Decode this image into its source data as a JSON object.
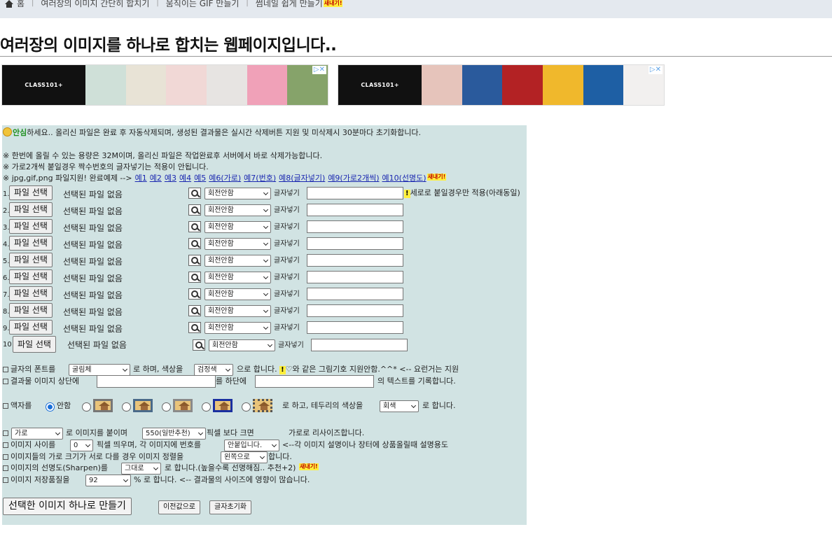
{
  "nav": {
    "home": "홈",
    "links": [
      "여러장의 이미지 간단히 합치기",
      "움직이는 GIF 만들기",
      "썸네일 쉽게 만들기"
    ],
    "new_badge": "새내기!"
  },
  "title": "여러장의 이미지를 하나로 합치는 웹페이지입니다..",
  "ads": [
    {
      "logo": "CLASS101+",
      "tiles": [
        "#cfe0d8",
        "#e8e3d6",
        "#f1d8d6",
        "#e7e4e2",
        "#f0a1b8",
        "#86a36a"
      ]
    },
    {
      "logo": "CLASS101+",
      "tiles": [
        "#e6c4bb",
        "#2a5a9c",
        "#b32224",
        "#f0b82c",
        "#1e5fa4",
        "#f2f0ef"
      ]
    }
  ],
  "notice": {
    "emph": "안심",
    "rest": "하세요.. 올리신 파일은 완료 후 자동삭제되며, 생성된 결과물은 실시간 삭제버튼 지원 및 미삭제시 30분마다 초기화합니다.",
    "line1": "※ 한번에 올릴 수 있는 용량은 32M이며, 올리신 파일은 작업완료후 서버에서 바로 삭제가능합니다.",
    "line2": "※ 가로2개씩 붙일경우 짝수번호의 글자넣기는 적용이 안됩니다.",
    "support_prefix": "※ jpg,gif,png 파일지원! 완료예제 -->",
    "examples": [
      "예1",
      "예2",
      "예3",
      "예4",
      "예5",
      "예6(가로)",
      "예7(번호)",
      "예8(글자넣기)",
      "예9(가로2개씩)",
      "예10(선명도)"
    ],
    "new_badge": "새내기!"
  },
  "file_rows": {
    "button_label": "파일 선택",
    "no_file": "선택된 파일 없음",
    "rotate": "회전안함",
    "text_label": "글자넣기",
    "numbers": [
      "1.",
      "2.",
      "3.",
      "4.",
      "5.",
      "6.",
      "7.",
      "8.",
      "9.",
      "10"
    ],
    "row1_note_badge": "!",
    "row1_note": "세로로 붙일경우만 적용(아래동일)"
  },
  "font_line": {
    "prefix": "글자의 폰트를",
    "font_value": "굴림체",
    "mid": "로 하며, 색상을",
    "color_value": "검정색",
    "suffix": "으로 합니다.",
    "badge": "!",
    "tail": "♡와 같은 그림기호 지원안함.^^* <-- 요런거는 지원"
  },
  "text_line": {
    "a": "결과물 이미지 상단에",
    "b": "를 하단에",
    "c": "의 텍스트를 기록합니다."
  },
  "frame_line": {
    "prefix": "액자를",
    "none_label": "안함",
    "mid": "로 하고, 테두리의 색상을",
    "border_value": "회색",
    "suffix": "로 합니다."
  },
  "options": {
    "dir_value": "가로",
    "dir_text": "로 이미지를 붙이며",
    "width_value": "550(일반추천)",
    "width_text": "픽셀 보다 크면",
    "width_text2": "가로로 리사이즈합니다.",
    "gap_prefix": "이미지 사이를",
    "gap_value": "0",
    "gap_text": "픽셀 띄우며, 각 이미지에 번호를",
    "num_value": "안붙입니다.",
    "num_text": "<--각 이미지 설명이나 장터에 상품올릴때 설명용도",
    "align_prefix": "이미지들의 가로 크기가 서로 다를 경우 이미지 정렬을",
    "align_value": "왼쪽으로",
    "align_suffix": "합니다.",
    "sharp_prefix": "이미지의 선명도(Sharpen)를",
    "sharp_value": "그대로",
    "sharp_text": "로 합니다.(높을수록 선명해짐.. 추천+2)",
    "sharp_badge": "새내기!",
    "quality_prefix": "이미지 저장품질을",
    "quality_value": "92",
    "quality_text": "% 로 합니다. <-- 결과물의 사이즈에 영향이 많습니다."
  },
  "buttons": {
    "main": "선택한 이미지 하나로 만들기",
    "prev": "이전값으로",
    "reset": "글자초기화"
  }
}
